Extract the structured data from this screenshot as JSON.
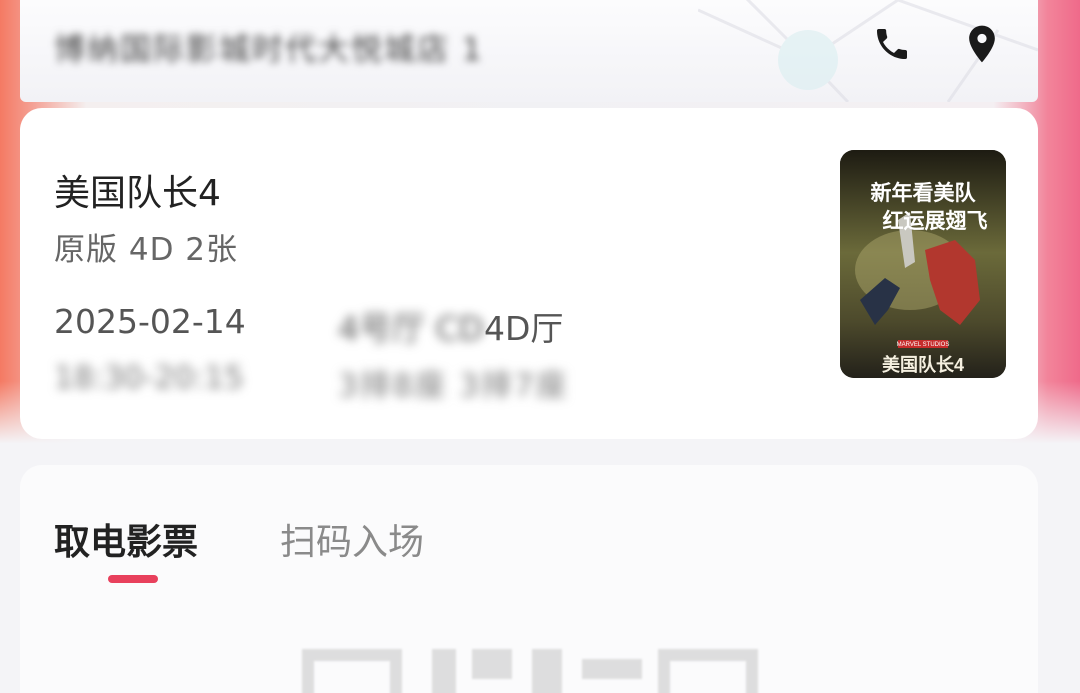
{
  "header": {
    "cinema_name": "博纳国际影城时代大悦城店 1",
    "phone_icon": "phone-icon",
    "location_icon": "location-pin-icon"
  },
  "ticket": {
    "movie_title": "美国队长4",
    "meta": "原版 4D 2张",
    "date": "2025-02-14",
    "time_range": "18:30-20:15",
    "hall_prefix": "4号厅 CD",
    "hall_suffix": "4D厅",
    "seats": "3排8座 3排7座",
    "poster": {
      "tagline_1": "新年看美队",
      "tagline_2": "红运展翅飞",
      "studio": "MARVEL STUDIOS",
      "title": "美国队长4"
    }
  },
  "pickup": {
    "tabs": [
      {
        "label": "取电影票",
        "active": true
      },
      {
        "label": "扫码入场",
        "active": false
      }
    ]
  },
  "colors": {
    "accent": "#e8405c",
    "text_primary": "#222222",
    "text_secondary": "#666666",
    "card_bg": "#ffffff"
  }
}
